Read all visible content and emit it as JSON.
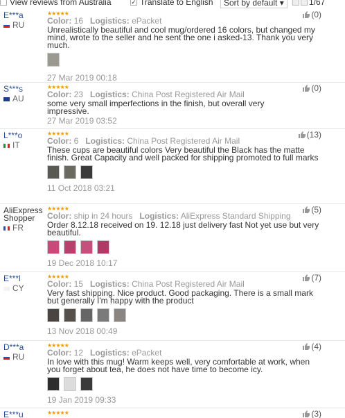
{
  "topbar": {
    "view_australia_label": "View reviews from Australia",
    "translate_label": "Translate to English",
    "sort_label": "Sort by default",
    "page_indicator": "1/67"
  },
  "reviews": [
    {
      "user": "E***a",
      "country": "RU",
      "color_label": "Color:",
      "color": "16",
      "logistics_label": "Logistics:",
      "logistics": "ePacket",
      "text": "Unrealistically beautiful and cool mug/ordered 16 colors, but changed my mind, wrote to the seller and he sent the one i asked-13. Thank you very much.",
      "date": "27 Mar 2019 00:18",
      "helpful": "(0)"
    },
    {
      "user": "S***s",
      "country": "AU",
      "color_label": "Color:",
      "color": "23",
      "logistics_label": "Logistics:",
      "logistics": "China Post Registered Air Mail",
      "text": "some very small imperfections in the finish, but overall very impressive.",
      "date": "27 Mar 2019 03:52",
      "helpful": "(0)"
    },
    {
      "user": "L***o",
      "country": "IT",
      "color_label": "Color:",
      "color": "6",
      "logistics_label": "Logistics:",
      "logistics": "China Post Registered Air Mail",
      "text": "These cups are beautiful colors Very beautiful the Black has the matte finish. Great Capacity and well packed for shipping promoted to full marks",
      "date": "11 Oct 2018 03:21",
      "helpful": "(13)"
    },
    {
      "user": "AliExpress Shopper",
      "country": "FR",
      "color_label": "Color:",
      "color": "ship in 24 hours",
      "logistics_label": "Logistics:",
      "logistics": "AliExpress Standard Shipping",
      "text": "Order 8.12.18 received on 19. 12.18 just delivery fast Not yet use but very beautiful.",
      "date": "19 Dec 2018 10:17",
      "helpful": "(5)"
    },
    {
      "user": "E***l",
      "country": "CY",
      "color_label": "Color:",
      "color": "15",
      "logistics_label": "Logistics:",
      "logistics": "China Post Registered Air Mail",
      "text": "Very fast shipping. Nice product. Good packaging. There is a small mark but generally I'm happy with the product",
      "date": "13 Nov 2018 00:49",
      "helpful": "(7)"
    },
    {
      "user": "D***a",
      "country": "RU",
      "color_label": "Color:",
      "color": "12",
      "logistics_label": "Logistics:",
      "logistics": "ePacket",
      "text": "In love with this mug! Warm keeps well, very comfortable at work, when you forget about tea, he does not have time to become icy.",
      "date": "19 Jan 2019 09:33",
      "helpful": "(4)"
    },
    {
      "user": "E***u",
      "country": "",
      "helpful": "(3)"
    }
  ],
  "colors": {
    "star": "#f09b00",
    "username": "#2a4f8f",
    "thumb_pink": "#c94a7a",
    "thumb_dark": "#3a3a3a",
    "thumb_grey": "#8c8c8c"
  }
}
